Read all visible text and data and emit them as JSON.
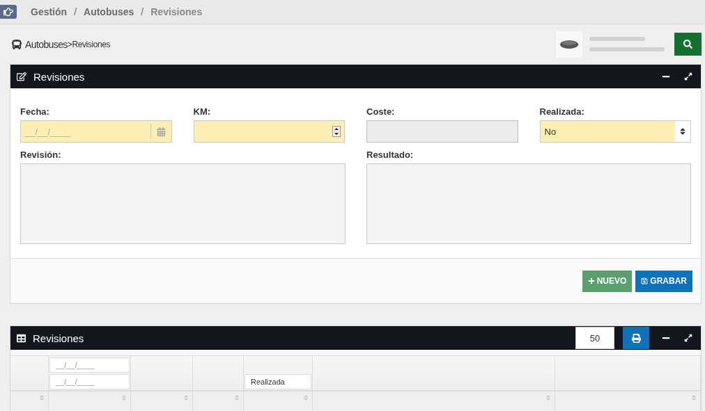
{
  "breadcrumb": {
    "items": [
      "Gestión",
      "Autobuses",
      "Revisiones"
    ],
    "separators": [
      "/",
      "/"
    ]
  },
  "page_path": {
    "parent": "Autobuses",
    "separator": ">",
    "current": "Revisiones"
  },
  "form_panel": {
    "title": "Revisiones",
    "fields": [
      {
        "label": "Fecha:",
        "kind": "date",
        "placeholder": "__/__/____",
        "required": true,
        "disabled": false
      },
      {
        "label": "KM:",
        "kind": "number",
        "required": true,
        "disabled": false
      },
      {
        "label": "Coste:",
        "kind": "text",
        "required": false,
        "disabled": true
      },
      {
        "label": "Realizada:",
        "kind": "select",
        "value": "No",
        "required": true,
        "disabled": false
      }
    ],
    "text_areas": [
      {
        "label": "Revisión:"
      },
      {
        "label": "Resultado:"
      }
    ],
    "buttons": [
      {
        "label": "NUEVO",
        "kind": "new"
      },
      {
        "label": "GRABAR",
        "kind": "save"
      }
    ]
  },
  "table_panel": {
    "title": "Revisiones",
    "page_size": "50",
    "filters": [
      {
        "kind": "none"
      },
      {
        "kind": "date_range",
        "placeholders": [
          "__/__/____",
          "__/__/____"
        ]
      },
      {
        "kind": "none"
      },
      {
        "kind": "none"
      },
      {
        "kind": "select",
        "value": "Realizada"
      },
      {
        "kind": "none"
      },
      {
        "kind": "none"
      }
    ]
  }
}
